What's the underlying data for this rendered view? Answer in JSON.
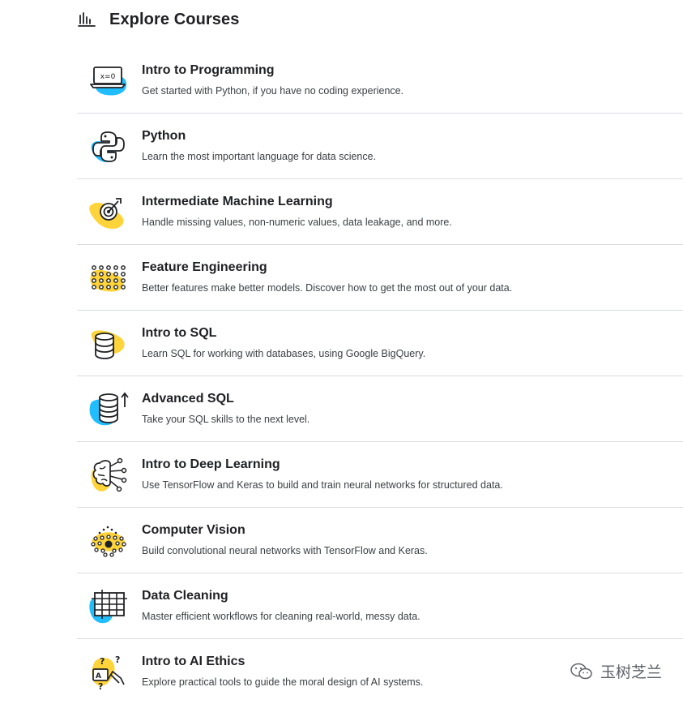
{
  "header": {
    "title": "Explore Courses",
    "icon": "bar-chart-icon"
  },
  "courses": [
    {
      "title": "Intro to Programming",
      "description": "Get started with Python, if you have no coding experience.",
      "icon": "laptop-equation-icon",
      "blob_color": "#20beff"
    },
    {
      "title": "Python",
      "description": "Learn the most important language for data science.",
      "icon": "python-logo-icon",
      "blob_color": "#20beff"
    },
    {
      "title": "Intermediate Machine Learning",
      "description": "Handle missing values, non-numeric values, data leakage, and more.",
      "icon": "target-icon",
      "blob_color": "#ffd43b"
    },
    {
      "title": "Feature Engineering",
      "description": "Better features make better models. Discover how to get the most out of your data.",
      "icon": "dot-grid-icon",
      "blob_color": "#ffd43b"
    },
    {
      "title": "Intro to SQL",
      "description": "Learn SQL for working with databases, using Google BigQuery.",
      "icon": "database-icon",
      "blob_color": "#ffd43b"
    },
    {
      "title": "Advanced SQL",
      "description": "Take your SQL skills to the next level.",
      "icon": "database-arrow-up-icon",
      "blob_color": "#20beff"
    },
    {
      "title": "Intro to Deep Learning",
      "description": "Use TensorFlow and Keras to build and train neural networks for structured data.",
      "icon": "brain-network-icon",
      "blob_color": "#ffd43b"
    },
    {
      "title": "Computer Vision",
      "description": "Build convolutional neural networks with TensorFlow and Keras.",
      "icon": "dot-eye-icon",
      "blob_color": "#ffd43b"
    },
    {
      "title": "Data Cleaning",
      "description": "Master efficient workflows for cleaning real-world, messy data.",
      "icon": "table-grid-icon",
      "blob_color": "#20beff"
    },
    {
      "title": "Intro to AI Ethics",
      "description": "Explore practical tools to guide the moral design of AI systems.",
      "icon": "ethics-questions-icon",
      "blob_color": "#ffd43b"
    }
  ],
  "watermark": {
    "text": "玉树芝兰",
    "icon": "wechat-icon"
  }
}
